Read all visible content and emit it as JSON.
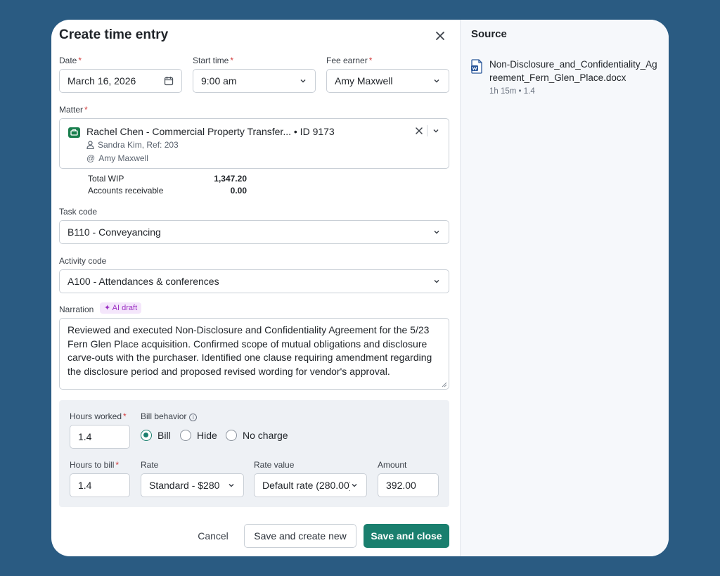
{
  "dialog": {
    "title": "Create time entry",
    "date": {
      "label": "Date",
      "required": "*",
      "value": "March 16, 2026"
    },
    "start_time": {
      "label": "Start time",
      "required": "*",
      "value": "9:00 am"
    },
    "fee_earner": {
      "label": "Fee earner",
      "required": "*",
      "value": "Amy Maxwell"
    },
    "matter": {
      "label": "Matter",
      "required": "*",
      "title": "Rachel Chen - Commercial Property Transfer... • ID 9173",
      "contact": "Sandra Kim, Ref: 203",
      "owner": "Amy Maxwell",
      "total_wip_label": "Total WIP",
      "total_wip": "1,347.20",
      "accounts_receivable_label": "Accounts receivable",
      "accounts_receivable": "0.00"
    },
    "task_code": {
      "label": "Task code",
      "value": "B110 - Conveyancing"
    },
    "activity_code": {
      "label": "Activity code",
      "value": "A100 - Attendances & conferences"
    },
    "narration": {
      "label": "Narration",
      "badge": "✦ AI draft",
      "text": "Reviewed and executed Non-Disclosure and Confidentiality Agreement for the 5/23 Fern Glen Place acquisition. Confirmed scope of mutual obligations and disclosure carve-outs with the purchaser. Identified one clause requiring amendment regarding the disclosure period and proposed revised wording for vendor's approval."
    },
    "hours_worked": {
      "label": "Hours worked",
      "required": "*",
      "value": "1.4"
    },
    "bill_behavior": {
      "label": "Bill behavior",
      "options": [
        "Bill",
        "Hide",
        "No charge"
      ],
      "selected": "Bill"
    },
    "hours_to_bill": {
      "label": "Hours to bill",
      "required": "*",
      "value": "1.4"
    },
    "rate": {
      "label": "Rate",
      "value": "Standard - $280"
    },
    "rate_value": {
      "label": "Rate value",
      "value": "Default rate (280.00)"
    },
    "amount": {
      "label": "Amount",
      "value": "392.00"
    },
    "buttons": {
      "cancel": "Cancel",
      "save_new": "Save and create new",
      "save_close": "Save and close"
    }
  },
  "source": {
    "title": "Source",
    "file_name": "Non-Disclosure_and_Confidentiality_Agreement_Fern_Glen_Place.docx",
    "file_meta": "1h 15m • 1.4"
  },
  "colors": {
    "background": "#2a5b82",
    "accent": "#1a7f6e",
    "required": "#d23b3b",
    "ai_badge": "#9b2fc2"
  }
}
